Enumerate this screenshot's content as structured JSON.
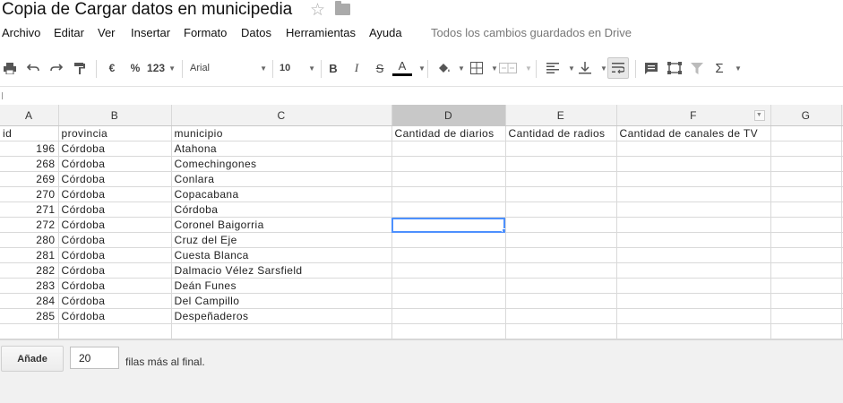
{
  "doc": {
    "title": "Copia de Cargar datos en municipedia"
  },
  "menu": {
    "items": [
      "Archivo",
      "Editar",
      "Ver",
      "Insertar",
      "Formato",
      "Datos",
      "Herramientas",
      "Ayuda"
    ],
    "save_status": "Todos los cambios guardados en Drive"
  },
  "toolbar": {
    "currency": "€",
    "percent": "%",
    "number_format": "123",
    "font": "Arial",
    "font_size": "10",
    "bold": "B",
    "italic": "I",
    "strike": "S",
    "text_color": "A",
    "sum": "Σ"
  },
  "colors": {
    "accent": "#4d90fe",
    "header_bg": "#f2f2f2",
    "selected_header": "#c8c8c8",
    "text_color_bar": "#000000"
  },
  "sheet": {
    "column_headers": [
      "A",
      "B",
      "C",
      "D",
      "E",
      "F",
      "G"
    ],
    "selected_column": "D",
    "header_row": [
      "id",
      "provincia",
      "municipio",
      "Cantidad de diarios",
      "Cantidad de radios",
      "Cantidad de canales de TV",
      ""
    ],
    "rows": [
      [
        "196",
        "Córdoba",
        "Atahona"
      ],
      [
        "268",
        "Córdoba",
        "Comechingones"
      ],
      [
        "269",
        "Córdoba",
        "Conlara"
      ],
      [
        "270",
        "Córdoba",
        "Copacabana"
      ],
      [
        "271",
        "Córdoba",
        "Córdoba"
      ],
      [
        "272",
        "Córdoba",
        "Coronel Baigorria"
      ],
      [
        "280",
        "Córdoba",
        "Cruz del Eje"
      ],
      [
        "281",
        "Córdoba",
        "Cuesta Blanca"
      ],
      [
        "282",
        "Córdoba",
        "Dalmacio Vélez Sarsfield"
      ],
      [
        "283",
        "Córdoba",
        "Deán Funes"
      ],
      [
        "284",
        "Córdoba",
        "Del Campillo"
      ],
      [
        "285",
        "Córdoba",
        "Despeñaderos"
      ]
    ],
    "active_cell": "D7"
  },
  "footer": {
    "add_label": "Añade",
    "rows_value": "20",
    "suffix_text": "filas más al final."
  }
}
